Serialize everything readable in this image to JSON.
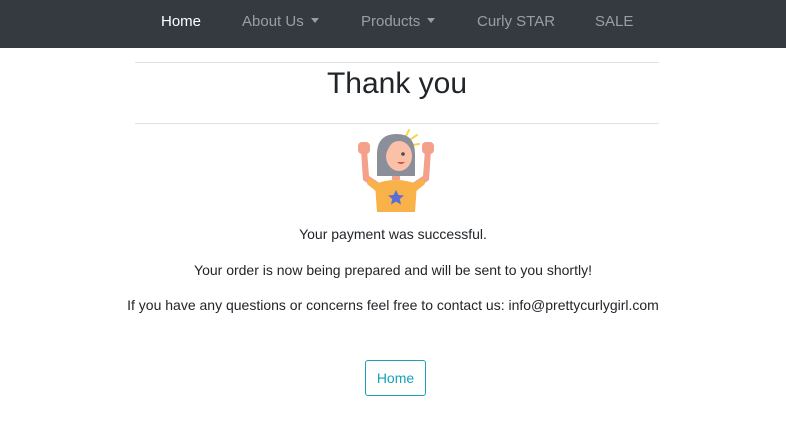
{
  "navbar": {
    "items": [
      {
        "label": "Home",
        "active": true
      },
      {
        "label": "About Us",
        "dropdown": true
      },
      {
        "label": "Products",
        "dropdown": true
      },
      {
        "label": "Curly STAR"
      },
      {
        "label": "SALE"
      }
    ]
  },
  "main": {
    "title": "Thank you",
    "messages": [
      "Your payment was successful.",
      "Your order is now being prepared and will be sent to you shortly!",
      "If you have any questions or concerns feel free to contact us: info@prettycurlygirl.com"
    ],
    "home_button_label": "Home"
  },
  "illustration": {
    "icon": "celebrating-girl-icon"
  },
  "colors": {
    "navbar_bg": "#343a40",
    "accent": "#17a2b8",
    "text": "#212529",
    "divider": "#dee2e6"
  }
}
